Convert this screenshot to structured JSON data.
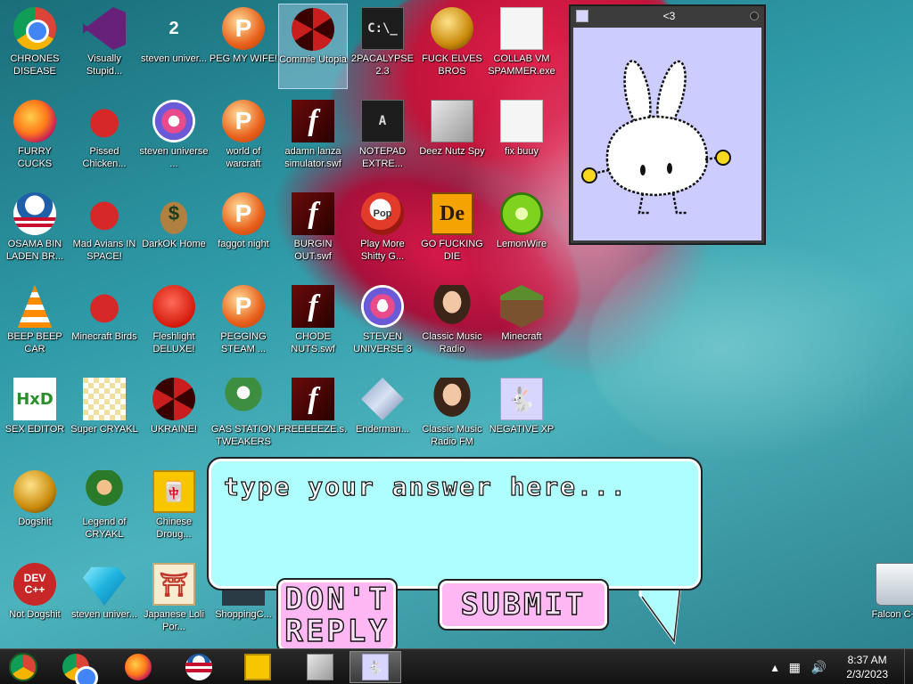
{
  "desktop": {
    "icons": [
      {
        "label": "CHRONES DISEASE",
        "icon": "chrome-icon"
      },
      {
        "label": "Visually Stupid...",
        "icon": "visual-studio-icon"
      },
      {
        "label": "steven univer...",
        "icon": "steven-universe-2-icon"
      },
      {
        "label": "PEG MY WIFE!",
        "icon": "popcap-peggle-icon"
      },
      {
        "label": "Commie Utopia",
        "icon": "papers-please-eagle-icon"
      },
      {
        "label": "2PACALYPSE 2.3",
        "icon": "command-prompt-icon"
      },
      {
        "label": "FUCK ELVES BROS",
        "icon": "santa-globe-icon"
      },
      {
        "label": "COLLAB VM SPAMMER.exe",
        "icon": "monitor-app-icon"
      },
      {
        "label": "FURRY CUCKS",
        "icon": "firefox-icon"
      },
      {
        "label": "Pissed Chicken...",
        "icon": "angry-birds-seasons-icon"
      },
      {
        "label": "steven universe ...",
        "icon": "steven-universe-gem-icon"
      },
      {
        "label": "world of warcraft",
        "icon": "peggle-icon"
      },
      {
        "label": "adamn lanza simulator.swf",
        "icon": "flash-icon"
      },
      {
        "label": "NOTEPAD EXTRE...",
        "icon": "notepad-flame-icon"
      },
      {
        "label": "Deez Nutz Spy",
        "icon": "stacked-files-icon"
      },
      {
        "label": "fix buuy",
        "icon": "script-file-icon"
      },
      {
        "label": "OSAMA BIN LADEN BR...",
        "icon": "obama-logo-icon"
      },
      {
        "label": "Mad Avians IN SPACE!",
        "icon": "angry-birds-space-icon"
      },
      {
        "label": "DarkOK Home",
        "icon": "money-bag-icon"
      },
      {
        "label": "faggot night",
        "icon": "peggle-nights-icon"
      },
      {
        "label": "BURGIN OUT.swf",
        "icon": "flash-icon"
      },
      {
        "label": "Play More Shitty G...",
        "icon": "popcap-icon"
      },
      {
        "label": "GO FUCKING DIE",
        "icon": "director-icon"
      },
      {
        "label": "LemonWire",
        "icon": "limewire-icon"
      },
      {
        "label": "BEEP BEEP CAR",
        "icon": "vlc-icon"
      },
      {
        "label": "Minecraft Birds",
        "icon": "angry-birds-icon"
      },
      {
        "label": "Fleshlight DELUXE!",
        "icon": "red-furball-icon"
      },
      {
        "label": "PEGGING STEAM ...",
        "icon": "peggle-icon"
      },
      {
        "label": "CHODE NUTS.swf",
        "icon": "flash-icon"
      },
      {
        "label": "STEVEN UNIVERSE 3",
        "icon": "bejeweled-3-icon"
      },
      {
        "label": "Classic Music Radio",
        "icon": "portrait-icon"
      },
      {
        "label": "Minecraft",
        "icon": "minecraft-block-icon"
      },
      {
        "label": "SEX EDITOR",
        "icon": "hxd-icon"
      },
      {
        "label": "Super CRYAKL",
        "icon": "cryakl-icon"
      },
      {
        "label": "UKRAINE!",
        "icon": "radiation-icon"
      },
      {
        "label": "GAS STATION TWEAKERS",
        "icon": "plants-vs-zombies-icon"
      },
      {
        "label": "FREEEEEZE.s...",
        "icon": "flash-icon"
      },
      {
        "label": "Enderman...",
        "icon": "diamond-file-icon"
      },
      {
        "label": "Classic Music Radio FM",
        "icon": "portrait-fm-icon"
      },
      {
        "label": "NEGATIVE XP",
        "icon": "bunny-icon"
      },
      {
        "label": "Dogshit",
        "icon": "cpp-ball-icon"
      },
      {
        "label": "Legend of CRYAKL",
        "icon": "ninja-icon"
      },
      {
        "label": "Chinese Droug...",
        "icon": "mahjong-icon"
      },
      {
        "label": "Not Dogshit",
        "icon": "dev-cpp-icon"
      },
      {
        "label": "steven univer...",
        "icon": "gem-icon"
      },
      {
        "label": "Japanese Loli Por...",
        "icon": "torii-icon"
      },
      {
        "label": "ShoppingC...",
        "icon": "app-icon"
      },
      {
        "label": "Falcon C++",
        "icon": "recycle-bin-icon"
      }
    ]
  },
  "bunny_window": {
    "title": "<3"
  },
  "dialog": {
    "answer_placeholder": "type your answer here...",
    "dont_reply_label": "DON'T REPLY",
    "submit_label": "SUBMIT"
  },
  "taskbar": {
    "pinned": [
      "chrome-icon",
      "firefox-icon",
      "obama-logo-icon",
      "file-explorer-icon",
      "network-app-icon",
      "bunny-icon"
    ],
    "time": "8:37 AM",
    "date": "2/3/2023"
  },
  "colors": {
    "answer_box": "#aefefe",
    "button_pink": "#ffb8f4",
    "window_canvas": "#ccccff"
  }
}
